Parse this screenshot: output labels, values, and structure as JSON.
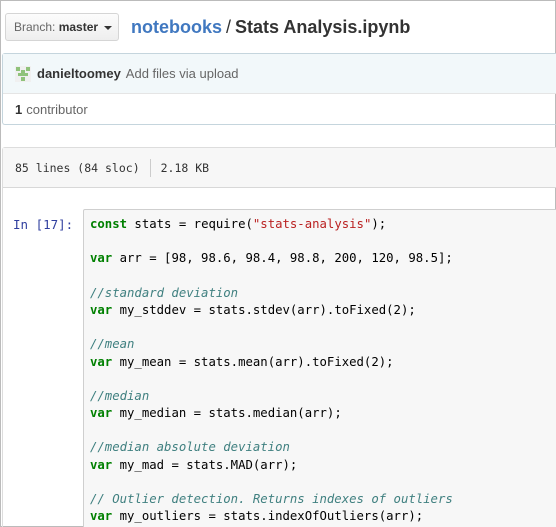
{
  "branch": {
    "prefix": "Branch:",
    "name": "master"
  },
  "breadcrumb": {
    "folder": "notebooks",
    "separator": "/",
    "file": "Stats Analysis.ipynb"
  },
  "commit": {
    "author": "danieltoomey",
    "message": "Add files via upload",
    "contributors_count": "1",
    "contributors_label": "contributor"
  },
  "file_info": {
    "lines": "85 lines (84 sloc)",
    "size": "2.18 KB"
  },
  "cell": {
    "prompt": "In [17]:",
    "code": [
      [
        {
          "t": "kw",
          "v": "const"
        },
        {
          "t": "",
          "v": " stats = require("
        },
        {
          "t": "str",
          "v": "\"stats-analysis\""
        },
        {
          "t": "",
          "v": ");"
        }
      ],
      [],
      [
        {
          "t": "kw",
          "v": "var"
        },
        {
          "t": "",
          "v": " arr = [98, 98.6, 98.4, 98.8, 200, 120, 98.5];"
        }
      ],
      [],
      [
        {
          "t": "cm",
          "v": "//standard deviation"
        }
      ],
      [
        {
          "t": "kw",
          "v": "var"
        },
        {
          "t": "",
          "v": " my_stddev = stats.stdev(arr).toFixed(2);"
        }
      ],
      [],
      [
        {
          "t": "cm",
          "v": "//mean"
        }
      ],
      [
        {
          "t": "kw",
          "v": "var"
        },
        {
          "t": "",
          "v": " my_mean = stats.mean(arr).toFixed(2);"
        }
      ],
      [],
      [
        {
          "t": "cm",
          "v": "//median"
        }
      ],
      [
        {
          "t": "kw",
          "v": "var"
        },
        {
          "t": "",
          "v": " my_median = stats.median(arr);"
        }
      ],
      [],
      [
        {
          "t": "cm",
          "v": "//median absolute deviation"
        }
      ],
      [
        {
          "t": "kw",
          "v": "var"
        },
        {
          "t": "",
          "v": " my_mad = stats.MAD(arr);"
        }
      ],
      [],
      [
        {
          "t": "cm",
          "v": "// Outlier detection. Returns indexes of outliers"
        }
      ],
      [
        {
          "t": "kw",
          "v": "var"
        },
        {
          "t": "",
          "v": " my_outliers = stats.indexOfOutliers(arr);"
        }
      ]
    ]
  },
  "colors": {
    "link": "#4078c0",
    "keyword": "#008000",
    "string": "#ba2121",
    "comment": "#408080",
    "prompt": "#303f9f"
  }
}
